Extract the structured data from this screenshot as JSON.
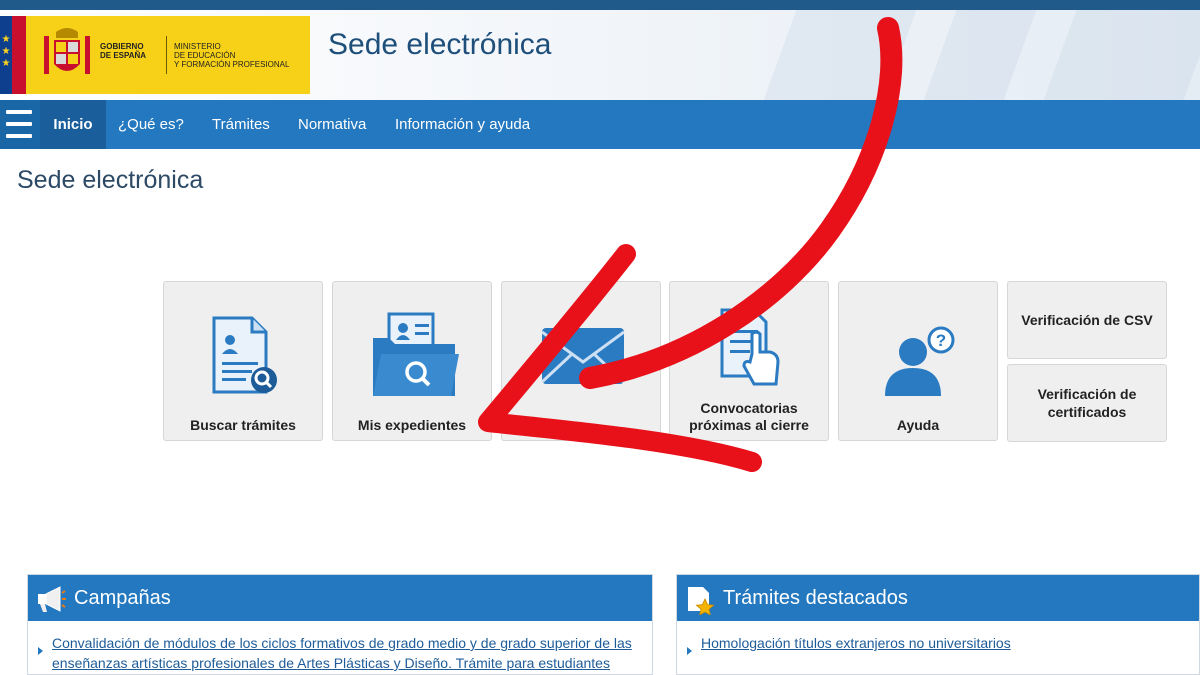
{
  "header": {
    "gov_line1": "GOBIERNO",
    "gov_line2": "DE ESPAÑA",
    "ministry_line1": "MINISTERIO",
    "ministry_line2": "DE EDUCACIÓN",
    "ministry_line3": "Y FORMACIÓN PROFESIONAL",
    "site_title": "Sede electrónica"
  },
  "nav": {
    "items": [
      "Inicio",
      "¿Qué es?",
      "Trámites",
      "Normativa",
      "Información y ayuda"
    ]
  },
  "page": {
    "title": "Sede electrónica"
  },
  "tiles": [
    {
      "label": "Buscar trámites",
      "icon": "search-document-icon"
    },
    {
      "label": "Mis expedientes",
      "icon": "folder-search-icon"
    },
    {
      "label": "",
      "icon": "envelope-icon"
    },
    {
      "label": "Convocatorias próximas al cierre",
      "icon": "document-touch-icon"
    },
    {
      "label": "Ayuda",
      "icon": "user-help-icon"
    }
  ],
  "side_tiles": [
    "Verificación de CSV",
    "Verificación de certificados"
  ],
  "panels": {
    "campaigns": {
      "title": "Campañas",
      "links": [
        "Convalidación de módulos de los ciclos formativos de grado medio y de grado superior de las enseñanzas artísticas profesionales de Artes Plásticas y Diseño. Trámite para estudiantes"
      ]
    },
    "featured": {
      "title": "Trámites destacados",
      "links": [
        "Homologación títulos extranjeros no universitarios"
      ]
    }
  },
  "colors": {
    "nav_blue": "#2378bf",
    "title_blue": "#1e4f7a",
    "gov_yellow": "#f7d117",
    "annotation_red": "#e8111a"
  }
}
